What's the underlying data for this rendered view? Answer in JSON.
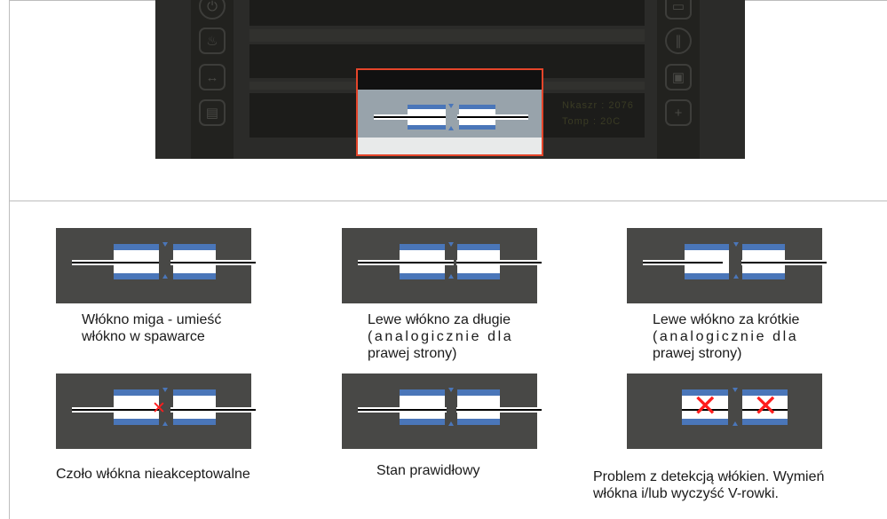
{
  "captions": {
    "blinking": [
      "Włókno miga - umieść",
      "włókno w spawarce"
    ],
    "left_long": [
      "Lewe włókno za długie",
      "(analogicznie dla",
      "prawej strony)"
    ],
    "left_short": [
      "Lewe włókno za krótkie",
      "(analogicznie dla",
      "prawej strony)"
    ],
    "face": [
      "Czoło włókna nieakceptowalne"
    ],
    "ok": [
      "Stan prawidłowy"
    ],
    "detection": [
      "Problem z detekcją włókien. Wymień",
      "włókna i/lub wyczyść V-rowki."
    ]
  },
  "device": {
    "readout": [
      "Nkaszr : 2076",
      "Tomp : 20C"
    ],
    "left_icons": [
      "power-icon",
      "arc-temperature-icon",
      "fiber-gap-icon",
      "fiber-view-icon"
    ],
    "right_icons": [
      "menu-icon",
      "pause-icon",
      "save-icon",
      "add-icon"
    ]
  },
  "colors": {
    "blue": "#4a76b9",
    "panel": "#484846",
    "screen": "#2b2b29",
    "highlight": "#e4452a",
    "error": "#ff1d1d"
  }
}
